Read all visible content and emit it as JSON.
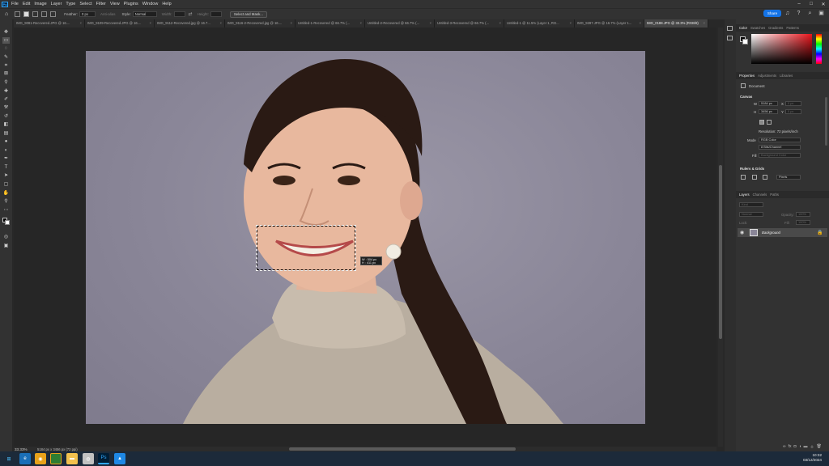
{
  "app": {
    "logo": "Ps",
    "menu": [
      "File",
      "Edit",
      "Image",
      "Layer",
      "Type",
      "Select",
      "Filter",
      "View",
      "Plugins",
      "Window",
      "Help"
    ]
  },
  "options": {
    "feather_label": "Feather:",
    "feather_value": "0 px",
    "antialias_label": "Anti-alias",
    "style_label": "Style:",
    "style_value": "Normal",
    "width_label": "Width:",
    "height_label": "Height:",
    "select_mask_label": "Select and Mask...",
    "share_label": "Share"
  },
  "tabs": [
    {
      "label": "IMG_9081-Recovered.JPG @ 16....",
      "active": false
    },
    {
      "label": "IMG_9109-Recovered.JPG @ 16....",
      "active": false
    },
    {
      "label": "IMG_9112-Recovered.jpg @ 16.7...",
      "active": false
    },
    {
      "label": "IMG_9116-2-Recovered.jpg @ 16....",
      "active": false
    },
    {
      "label": "Untitled-1-Recovered @ 66.7% (...",
      "active": false
    },
    {
      "label": "Untitled-2-Recovered @ 66.7% (...",
      "active": false
    },
    {
      "label": "Untitled-3-Recovered @ 66.7% (...",
      "active": false
    },
    {
      "label": "Untitled-1 @ 11.5% (Layer 1, RG...",
      "active": false
    },
    {
      "label": "IMG_9287.JPG @ 16.7% (Layer 1...",
      "active": false
    },
    {
      "label": "IMG_0188.JPG @ 33.3% (RGB/8)",
      "active": true
    }
  ],
  "canvas": {
    "measure_w": "W : 504 px",
    "measure_h": "H : 411 px"
  },
  "status": {
    "zoom": "33.33%",
    "doc": "5184 px x 3456 px (72 ppi)"
  },
  "color_panel": {
    "tabs": [
      "Color",
      "Swatches",
      "Gradients",
      "Patterns"
    ],
    "fg_color": "#000000",
    "bg_color": "#ffffff"
  },
  "properties": {
    "tabs": [
      "Properties",
      "Adjustments",
      "Libraries"
    ],
    "document_label": "Document",
    "canvas_label": "Canvas",
    "w_label": "W",
    "w_value": "5184 px",
    "x_label": "X",
    "x_value": "0 px",
    "h_label": "H",
    "h_value": "3456 px",
    "y_label": "Y",
    "y_value": "0 px",
    "resolution": "Resolution: 72 pixels/inch",
    "mode_label": "Mode",
    "mode_value": "RGB Color",
    "depth_value": "8 Bits/Channel",
    "fill_label": "Fill",
    "fill_value": "Background Color",
    "rulers_label": "Rulers & Grids",
    "units_value": "Pixels"
  },
  "layers": {
    "tabs": [
      "Layers",
      "Channels",
      "Paths"
    ],
    "kind_value": "Kind",
    "blend_value": "Normal",
    "opacity_label": "Opacity:",
    "opacity_value": "100%",
    "lock_label": "Lock:",
    "fill_label": "Fill:",
    "fill_value": "100%",
    "layer_name": "Background"
  },
  "taskbar": {
    "time": "10:32",
    "date": "03/12/2024"
  }
}
